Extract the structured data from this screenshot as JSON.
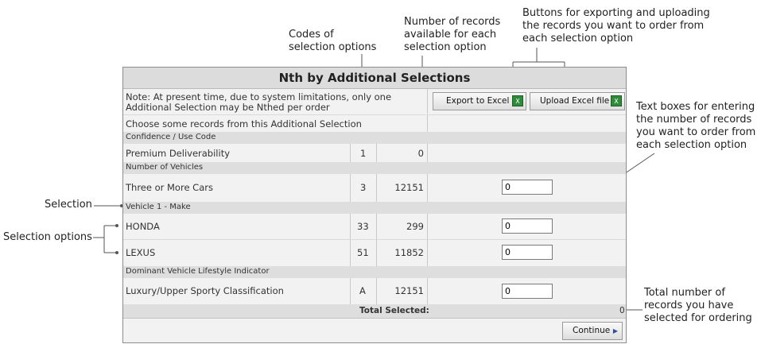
{
  "annotations": {
    "codes": "Codes of\nselection options",
    "records_available": "Number of records\navailable for each\nselection option",
    "buttons": "Buttons for exporting and uploading\nthe records you want to order from\neach selection option",
    "text_boxes": "Text boxes for entering\nthe number of records\nyou want to order from\neach selection option",
    "selection": "Selection",
    "selection_options": "Selection options",
    "total_number": "Total number of\nrecords you have\nselected for ordering"
  },
  "panel": {
    "title": "Nth by Additional Selections",
    "note": "Note: At present time, due to system limitations, only one\nAdditional Selection may be Nthed per order",
    "export_label": "Export to Excel",
    "upload_label": "Upload Excel file",
    "choose_text": "Choose some records from this Additional Selection",
    "total_label": "Total Selected:",
    "total_value": "0",
    "continue_label": "Continue"
  },
  "groups": [
    {
      "header": "Confidence / Use Code",
      "rows": [
        {
          "label": "Premium Deliverability",
          "code": "1",
          "count": "0"
        }
      ]
    },
    {
      "header": "Number of Vehicles",
      "rows": [
        {
          "label": "Three or More Cars",
          "code": "3",
          "count": "12151",
          "input": "0"
        }
      ]
    },
    {
      "header": "Vehicle 1 - Make",
      "rows": [
        {
          "label": "HONDA",
          "code": "33",
          "count": "299",
          "input": "0"
        },
        {
          "label": "LEXUS",
          "code": "51",
          "count": "11852",
          "input": "0"
        }
      ]
    },
    {
      "header": "Dominant Vehicle Lifestyle Indicator",
      "rows": [
        {
          "label": "Luxury/Upper Sporty Classification",
          "code": "A",
          "count": "12151",
          "input": "0"
        }
      ]
    }
  ],
  "icons": {
    "excel": "excel-icon",
    "arrow": "right-arrow-icon"
  }
}
